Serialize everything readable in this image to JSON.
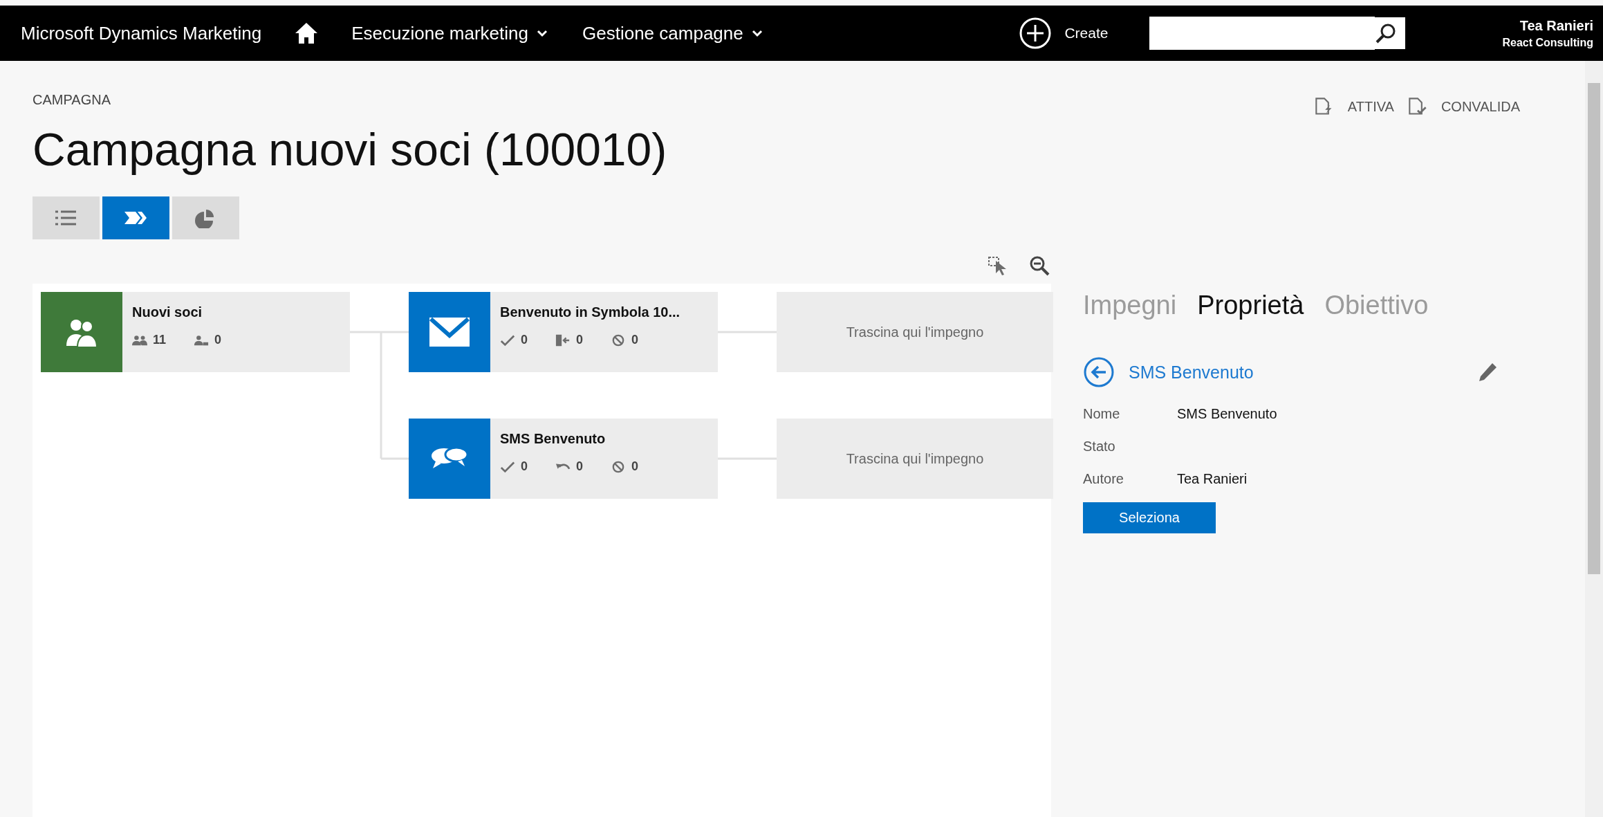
{
  "top_bar": {
    "app_title": "Microsoft Dynamics Marketing",
    "menus": [
      {
        "label": "Esecuzione marketing"
      },
      {
        "label": "Gestione campagne"
      }
    ],
    "create_label": "Create",
    "user": {
      "name": "Tea Ranieri",
      "company": "React Consulting"
    }
  },
  "header": {
    "breadcrumb": "CAMPAGNA",
    "title": "Campagna nuovi soci (100010)",
    "actions": [
      {
        "kind": "activate",
        "label": "ATTIVA"
      },
      {
        "kind": "validate",
        "label": "CONVALIDA"
      }
    ],
    "views": [
      {
        "kind": "list",
        "selected": false
      },
      {
        "kind": "flow",
        "selected": true
      },
      {
        "kind": "chart",
        "selected": false
      }
    ]
  },
  "canvas": {
    "segment": {
      "title": "Nuovi soci",
      "stats": [
        {
          "kind": "members",
          "value": "11"
        },
        {
          "kind": "excluded",
          "value": "0"
        }
      ]
    },
    "activities": [
      {
        "kind": "email",
        "title": "Benvenuto in Symbola 10...",
        "stats": [
          {
            "kind": "sent",
            "value": "0"
          },
          {
            "kind": "exit",
            "value": "0"
          },
          {
            "kind": "blocked",
            "value": "0"
          }
        ],
        "drop_label": "Trascina qui l'impegno"
      },
      {
        "kind": "sms",
        "title": "SMS Benvenuto",
        "stats": [
          {
            "kind": "sent",
            "value": "0"
          },
          {
            "kind": "reply",
            "value": "0"
          },
          {
            "kind": "blocked",
            "value": "0"
          }
        ],
        "drop_label": "Trascina qui l'impegno"
      }
    ]
  },
  "panel": {
    "tabs": [
      {
        "label": "Impegni",
        "selected": false
      },
      {
        "label": "Proprietà",
        "selected": true
      },
      {
        "label": "Obiettivo",
        "selected": false
      }
    ],
    "record_title": "SMS Benvenuto",
    "fields": [
      {
        "label": "Nome",
        "value": "SMS Benvenuto"
      },
      {
        "label": "Stato"
      },
      {
        "label": "Autore",
        "value": "Tea Ranieri"
      }
    ],
    "button": "Seleziona"
  }
}
